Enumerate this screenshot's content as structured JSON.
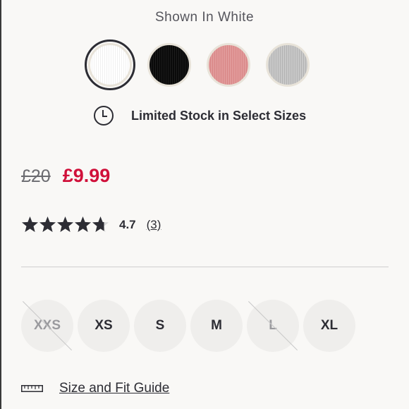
{
  "colour": {
    "shown_in": "Shown In White",
    "swatches": [
      {
        "name": "White",
        "hex": "#ffffff",
        "selected": true
      },
      {
        "name": "Black",
        "hex": "#111111",
        "selected": false
      },
      {
        "name": "Pink",
        "hex": "#df9393",
        "selected": false
      },
      {
        "name": "Grey",
        "hex": "#bebebe",
        "selected": false
      }
    ]
  },
  "stock": {
    "icon": "clock-icon",
    "message": "Limited Stock in Select Sizes"
  },
  "price": {
    "original": "£20",
    "sale": "£9.99",
    "sale_color": "#d0103a"
  },
  "rating": {
    "value": "4.7",
    "count": "(3)",
    "stars_out_of": 5,
    "stars_value": 4.7
  },
  "sizes": [
    {
      "label": "XXS",
      "available": false
    },
    {
      "label": "XS",
      "available": true
    },
    {
      "label": "S",
      "available": true
    },
    {
      "label": "M",
      "available": true
    },
    {
      "label": "L",
      "available": false
    },
    {
      "label": "XL",
      "available": true
    }
  ],
  "size_guide": {
    "icon": "ruler-icon",
    "label": "Size and Fit Guide"
  }
}
